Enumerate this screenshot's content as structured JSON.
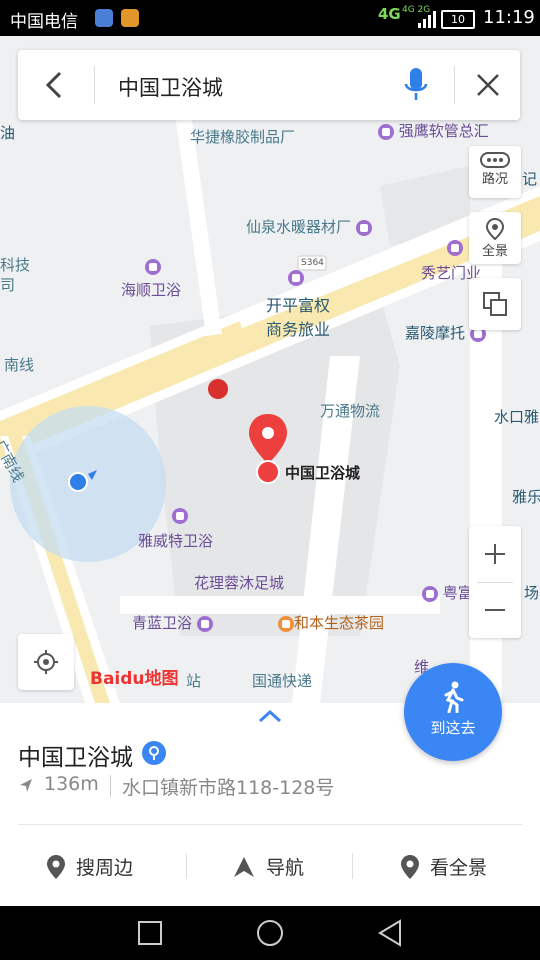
{
  "status_bar": {
    "carrier": "中国电信",
    "network": "4G",
    "network_small": "4G 2G",
    "battery": "10",
    "time": "11:19"
  },
  "search": {
    "query": "中国卫浴城"
  },
  "map": {
    "road_label": "S364",
    "logo": "Baidu地图",
    "pois": [
      {
        "label": "华捷橡胶制品厂"
      },
      {
        "label": "强鹰软管总汇"
      },
      {
        "label": "仙泉水暖器材厂"
      },
      {
        "label": "科技"
      },
      {
        "label": "司"
      },
      {
        "label": "海顺卫浴"
      },
      {
        "label": "秀艺门业"
      },
      {
        "label": "开平富权"
      },
      {
        "label": "商务旅业"
      },
      {
        "label": "嘉陵摩托"
      },
      {
        "label": "南线"
      },
      {
        "label": "万通物流"
      },
      {
        "label": "水口雅"
      },
      {
        "label": "广南线"
      },
      {
        "label": "中国卫浴城"
      },
      {
        "label": "雅威特卫浴"
      },
      {
        "label": "雅乐"
      },
      {
        "label": "花理蓉沐足城"
      },
      {
        "label": "粤富"
      },
      {
        "label": "场"
      },
      {
        "label": "青蓝卫浴"
      },
      {
        "label": "和本生态茶园"
      },
      {
        "label": "站"
      },
      {
        "label": "国通快递"
      },
      {
        "label": "维"
      },
      {
        "label": "油"
      },
      {
        "label": "记"
      }
    ]
  },
  "controls": {
    "traffic": "路况",
    "panorama": "全景"
  },
  "place": {
    "title": "中国卫浴城",
    "distance": "136m",
    "address": "水口镇新市路118-128号"
  },
  "actions": {
    "nearby": "搜周边",
    "navigate": "导航",
    "panorama": "看全景",
    "goto": "到这去"
  },
  "colors": {
    "accent": "#3b86f5",
    "marker": "#ee3f3f",
    "poi_purple": "#9e6fd1",
    "road_yellow": "#f7e6a6"
  }
}
